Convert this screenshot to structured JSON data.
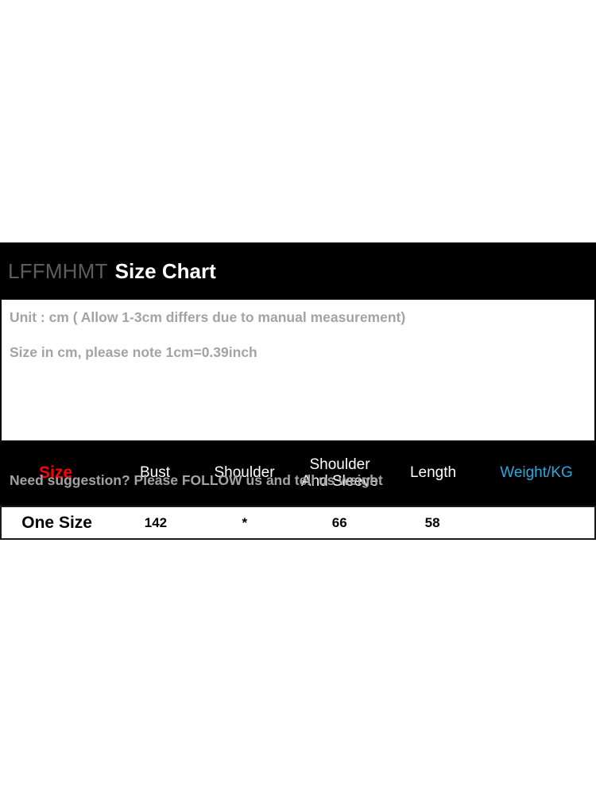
{
  "panel": {
    "brand": "LFFMHMT",
    "title": "Size Chart",
    "notes": [
      "Unit : cm ( Allow 1-3cm differs due to manual measurement)",
      "Size in cm, please note 1cm=0.39inch"
    ],
    "follow_note": "Need suggestion? Please FOLLOW us and tell us weight",
    "colors": {
      "panel_background": "#000000",
      "notes_background": "#ffffff",
      "brand_text": "#5d5d5d",
      "title_text": "#ffffff",
      "note_text": "#a3a3a3",
      "size_header": "#ff0000",
      "weight_header": "#29a8e0",
      "header_text": "#ffffff",
      "data_text": "#000000"
    }
  },
  "chart_data": {
    "type": "table",
    "title": "LFFMHMT Size Chart",
    "columns": [
      "Size",
      "Bust",
      "Shoulder",
      "Shoulder And Sleeve",
      "Length",
      "Weight/KG"
    ],
    "column_labels": {
      "size": "Size",
      "bust": "Bust",
      "shoulder": "Shoulder",
      "shoulder_and_sleeve_line1": "Shoulder",
      "shoulder_and_sleeve_line2": "And Sleeve",
      "length": "Length",
      "weight": "Weight/KG"
    },
    "rows": [
      {
        "size": "One Size",
        "bust": "142",
        "shoulder": "*",
        "shoulder_and_sleeve": "66",
        "length": "58",
        "weight": ""
      }
    ],
    "unit": "cm",
    "notes": [
      "Unit : cm ( Allow 1-3cm differs due to manual measurement)",
      "Size in cm, please note 1cm=0.39inch",
      "Need suggestion? Please FOLLOW us and tell us weight"
    ]
  }
}
